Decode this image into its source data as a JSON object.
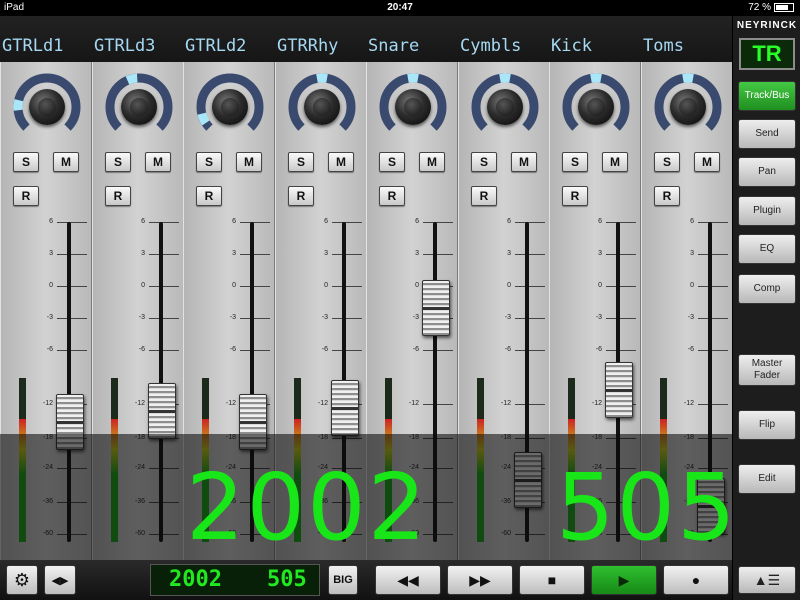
{
  "status": {
    "device": "iPad",
    "time": "20:47",
    "battery": "72 %"
  },
  "brand": "NEYRINCK",
  "mode_badge": "TR",
  "channels": [
    {
      "name": "GTRLd1",
      "fader": 0.32,
      "knob": 0.18,
      "meter": 0.75
    },
    {
      "name": "GTRLd3",
      "fader": 0.36,
      "knob": 0.45,
      "meter": 0.75
    },
    {
      "name": "GTRLd2",
      "fader": 0.32,
      "knob": 0.08,
      "meter": 0.75
    },
    {
      "name": "GTRRhy",
      "fader": 0.37,
      "knob": 0.5,
      "meter": 0.75
    },
    {
      "name": "Snare",
      "fader": 0.75,
      "knob": 0.5,
      "meter": 0.75
    },
    {
      "name": "Cymbls",
      "fader": 0.1,
      "knob": 0.5,
      "meter": 0.75
    },
    {
      "name": "Kick",
      "fader": 0.44,
      "knob": 0.5,
      "meter": 0.75
    },
    {
      "name": "Toms",
      "fader": 0.0,
      "knob": 0.5,
      "meter": 0.75
    }
  ],
  "strip_buttons": {
    "solo": "S",
    "mute": "M",
    "record": "R"
  },
  "scale": [
    "6",
    "3",
    "0",
    "-3",
    "-6",
    "-12",
    "-18",
    "-24",
    "-36",
    "-60"
  ],
  "big_counter": {
    "bars": "2002",
    "beats": "505"
  },
  "transport": {
    "counter_bars": "2002",
    "counter_beats": "505",
    "big_label": "BIG",
    "settings_icon": "gear-icon",
    "rewind_glyph": "◀◀",
    "ffwd_glyph": "▶▶",
    "stop_glyph": "■",
    "play_glyph": "▶",
    "record_glyph": "●",
    "nudge_glyph": "◀▶",
    "menu_glyph": "▲☰"
  },
  "side_buttons": [
    {
      "label": "Track/Bus",
      "active": true
    },
    {
      "label": "Send",
      "active": false
    },
    {
      "label": "Pan",
      "active": false
    },
    {
      "label": "Plugin",
      "active": false
    },
    {
      "label": "EQ",
      "active": false
    },
    {
      "label": "Comp",
      "active": false
    },
    {
      "label": "Master Fader",
      "active": false
    },
    {
      "label": "Flip",
      "active": false
    },
    {
      "label": "Edit",
      "active": false
    }
  ],
  "colors": {
    "accent_green": "#19e619",
    "name_text": "#a6d8f2",
    "knob_ring": "#3a4a6e",
    "knob_indicator": "#a8e6f8"
  }
}
